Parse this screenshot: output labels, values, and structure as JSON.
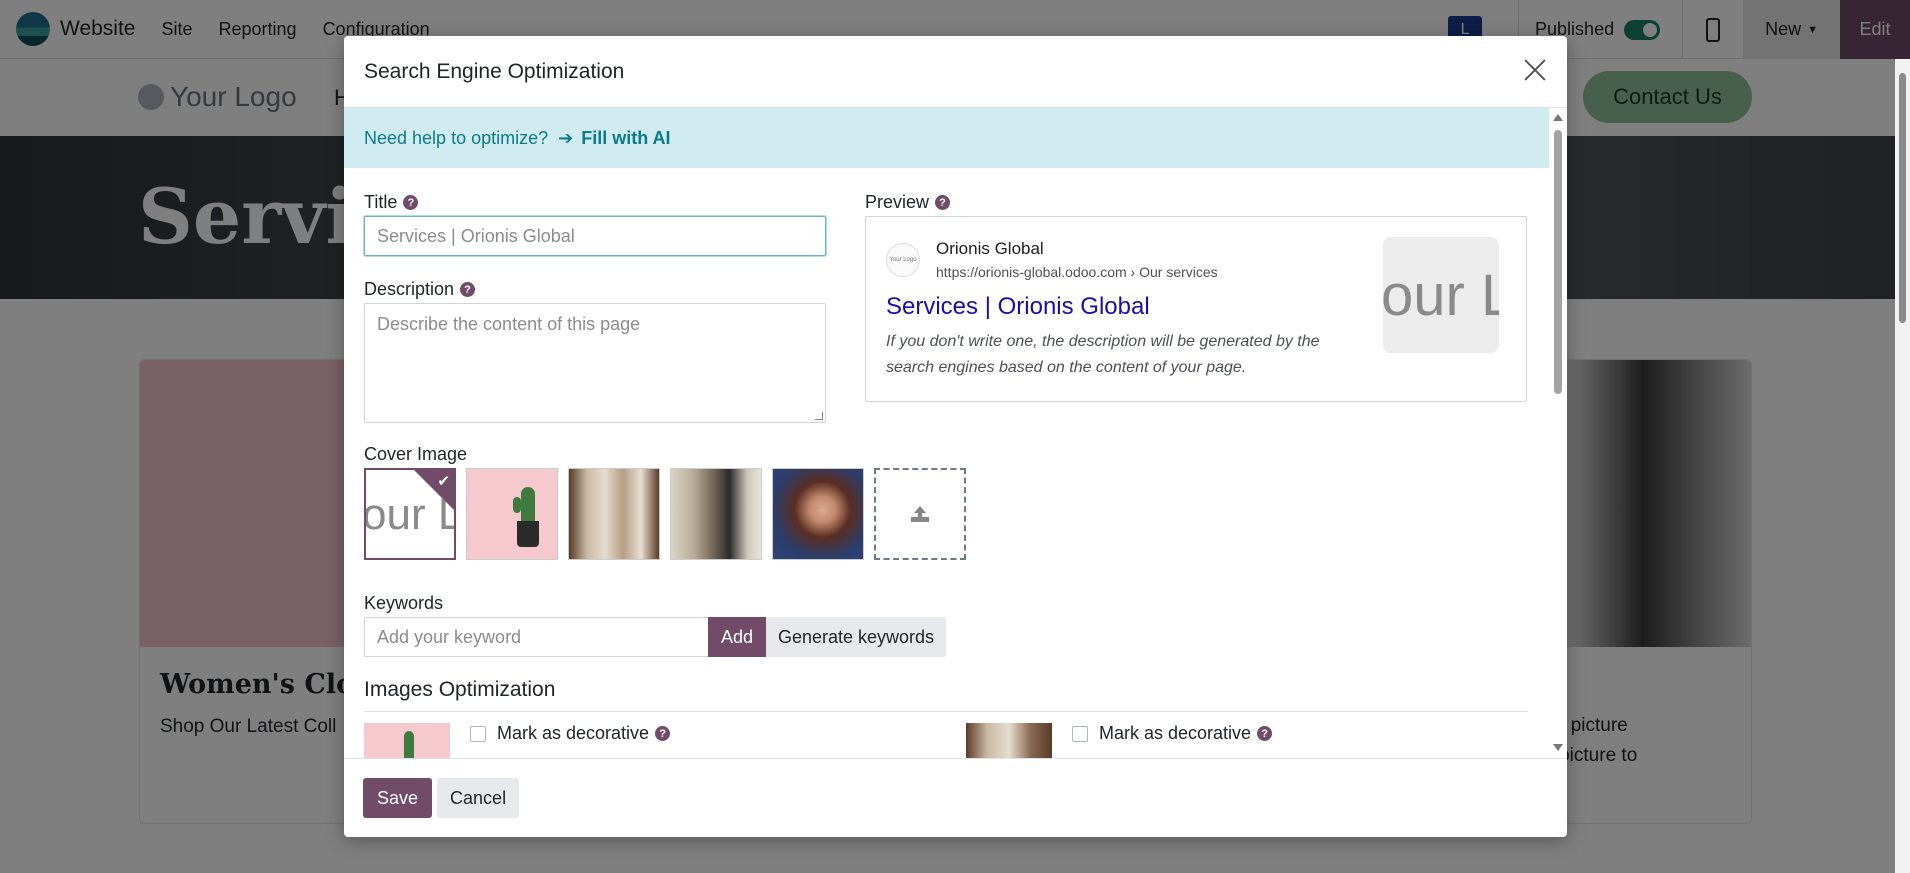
{
  "navbar": {
    "app_name": "Website",
    "menu": [
      "Site",
      "Reporting",
      "Configuration"
    ],
    "user_initial": "L",
    "published_label": "Published",
    "published": true,
    "new_label": "New",
    "edit_label": "Edit"
  },
  "site": {
    "logo_text": "Your Logo",
    "menu_partial": "H",
    "contact_label": "Contact Us",
    "hero_title_partial": "Servic",
    "card_left_title": "Women's Cloth",
    "card_left_text": "Shop Our Latest Coll",
    "card_right_text_1": "it with a picture",
    "card_right_text_2": "on the picture to"
  },
  "modal": {
    "title": "Search Engine Optimization",
    "help_text": "Need help to optimize?",
    "fill_ai_label": "Fill with AI",
    "title_label": "Title",
    "title_value": "Services | Orionis Global",
    "description_label": "Description",
    "description_placeholder": "Describe the content of this page",
    "preview_label": "Preview",
    "preview": {
      "favicon_text": "Your Logo",
      "site_name": "Orionis Global",
      "url": "https://orionis-global.odoo.com › Our services",
      "title": "Services | Orionis Global",
      "description": "If you don't write one, the description will be generated by the search engines based on the content of your page.",
      "thumb_text": "our L"
    },
    "cover_label": "Cover Image",
    "cover_selected_text": "our L",
    "keywords_label": "Keywords",
    "keyword_placeholder": "Add your keyword",
    "add_label": "Add",
    "generate_label": "Generate keywords",
    "images_optimization_title": "Images Optimization",
    "decorative_label": "Mark as decorative",
    "save_label": "Save",
    "cancel_label": "Cancel"
  },
  "colors": {
    "brand": "#714b67",
    "banner_bg": "#d1ecf1",
    "banner_text": "#0c7c8c",
    "link": "#1a0dab",
    "toggle_on": "#1a7f64"
  }
}
